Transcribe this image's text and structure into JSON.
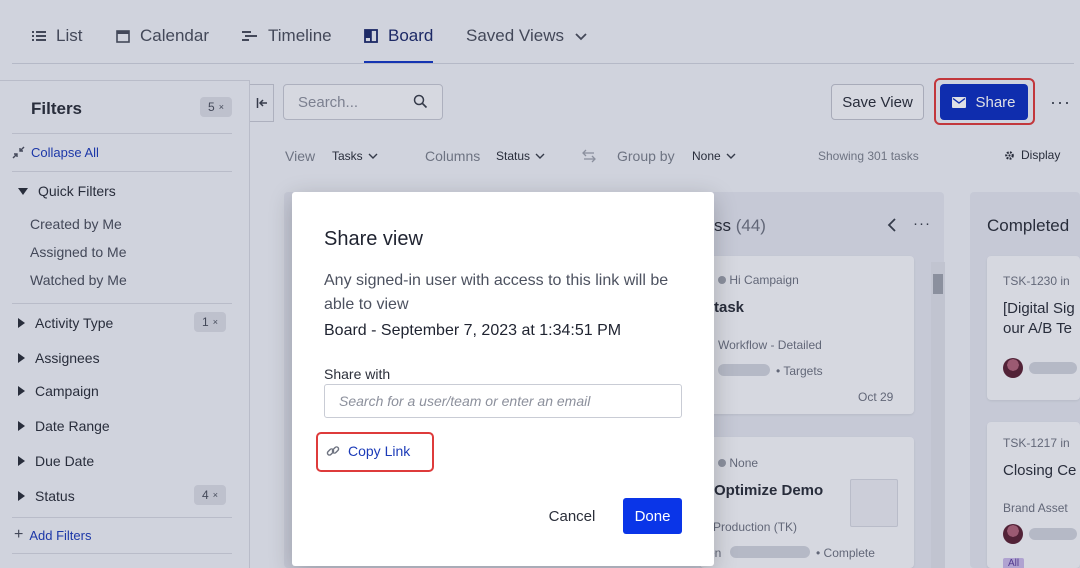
{
  "tabs": [
    {
      "label": "List",
      "icon": "list-icon"
    },
    {
      "label": "Calendar",
      "icon": "calendar-icon"
    },
    {
      "label": "Timeline",
      "icon": "timeline-icon"
    },
    {
      "label": "Board",
      "icon": "board-icon",
      "active": true
    },
    {
      "label": "Saved Views",
      "icon": "chevron-down-icon"
    }
  ],
  "sidebar": {
    "title": "Filters",
    "filter_count": "5",
    "collapse_all": "Collapse All",
    "quick_filters": {
      "label": "Quick Filters",
      "items": [
        "Created by Me",
        "Assigned to Me",
        "Watched by Me"
      ]
    },
    "groups": [
      {
        "label": "Activity Type",
        "count": "1"
      },
      {
        "label": "Assignees",
        "count": ""
      },
      {
        "label": "Campaign",
        "count": ""
      },
      {
        "label": "Date Range",
        "count": ""
      },
      {
        "label": "Due Date",
        "count": ""
      },
      {
        "label": "Status",
        "count": "4"
      }
    ],
    "add_filters": "Add Filters"
  },
  "toolbar": {
    "search_placeholder": "Search...",
    "save_view": "Save View",
    "share": "Share",
    "more": "···",
    "view_label": "View",
    "view_value": "Tasks",
    "columns_label": "Columns",
    "columns_value": "Status",
    "group_label": "Group by",
    "group_value": "None",
    "showing": "Showing 301 tasks",
    "display": "Display"
  },
  "board": {
    "column_mid": {
      "title": "ss",
      "count": "(44)"
    },
    "column_right": {
      "title": "Completed"
    },
    "mid_cards": [
      {
        "meta_a": "n",
        "meta_b": "Hi Campaign",
        "title": "task",
        "sub": "n Workflow - Detailed",
        "tag": "Targets",
        "date": "Oct 29"
      },
      {
        "meta_a": "n",
        "meta_b": "None",
        "title": "Optimize Demo",
        "sub": "Production (TK)",
        "tag": "Complete",
        "owner": "en"
      }
    ],
    "right_cards": [
      {
        "id": "TSK-1230 in",
        "title_1": "[Digital Sig",
        "title_2": "our A/B Te"
      },
      {
        "id": "TSK-1217 in",
        "title_1": "Closing Ce",
        "sub": "Brand Asset",
        "badge": "All"
      }
    ]
  },
  "modal": {
    "title": "Share view",
    "description": "Any signed-in user with access to this link will be able to view",
    "view_name": "Board - September 7, 2023 at 1:34:51 PM",
    "share_with_label": "Share with",
    "share_with_placeholder": "Search for a user/team or enter an email",
    "copy_link": "Copy Link",
    "cancel": "Cancel",
    "done": "Done"
  },
  "colors": {
    "primary": "#0d2fbf",
    "done": "#0a35e8",
    "highlight": "#de3b3b",
    "link": "#1c3bb8"
  }
}
